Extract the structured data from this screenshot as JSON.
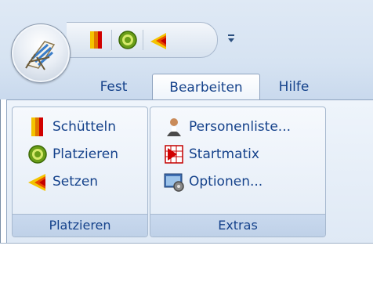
{
  "app_button": {
    "icon": "beach-chair-icon"
  },
  "quick_access": [
    {
      "icon": "shake-icon",
      "tooltip": ""
    },
    {
      "icon": "target-icon",
      "tooltip": ""
    },
    {
      "icon": "place-arrow-icon",
      "tooltip": ""
    }
  ],
  "tabs": [
    {
      "label": "Fest",
      "active": false
    },
    {
      "label": "Bearbeiten",
      "active": true
    },
    {
      "label": "Hilfe",
      "active": false
    }
  ],
  "groups": [
    {
      "label": "Platzieren",
      "buttons": [
        {
          "label": "Schütteln",
          "icon": "shake-icon"
        },
        {
          "label": "Platzieren",
          "icon": "target-icon"
        },
        {
          "label": "Setzen",
          "icon": "place-arrow-icon"
        }
      ]
    },
    {
      "label": "Extras",
      "buttons": [
        {
          "label": "Personenliste...",
          "icon": "person-list-icon"
        },
        {
          "label": "Startmatix",
          "icon": "start-matrix-icon"
        },
        {
          "label": "Optionen...",
          "icon": "options-icon"
        }
      ]
    }
  ],
  "colors": {
    "accent_text": "#15428b",
    "ribbon_bg": "#dfe9f5"
  }
}
